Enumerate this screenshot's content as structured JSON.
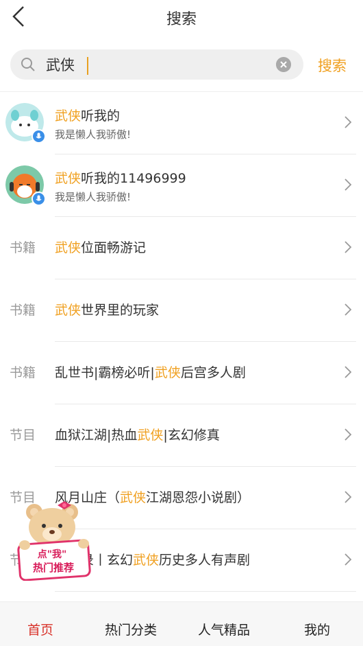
{
  "header": {
    "title": "搜索"
  },
  "search": {
    "value": "武侠",
    "button_label": "搜索"
  },
  "users": [
    {
      "title_highlight": "武侠",
      "title_rest": "听我的",
      "subtitle": "我是懒人我骄傲!"
    },
    {
      "title_highlight": "武侠",
      "title_rest": "听我的11496999",
      "subtitle": "我是懒人我骄傲!"
    }
  ],
  "results": [
    {
      "category": "书籍",
      "pre": "",
      "hl": "武侠",
      "post": "位面畅游记"
    },
    {
      "category": "书籍",
      "pre": "",
      "hl": "武侠",
      "post": "世界里的玩家"
    },
    {
      "category": "书籍",
      "pre": "乱世书|霸榜必听|",
      "hl": "武侠",
      "post": "后宫多人剧"
    },
    {
      "category": "节目",
      "pre": "血狱江湖|热血",
      "hl": "武侠",
      "post": "|玄幻修真"
    },
    {
      "category": "节目",
      "pre": "风月山庄（",
      "hl": "武侠",
      "post": "江湖恩怨小说剧）"
    },
    {
      "category": "节目",
      "pre": "剑灵录丨玄幻",
      "hl": "武侠",
      "post": "历史多人有声剧"
    }
  ],
  "promo": {
    "line1": "点\"我\"",
    "line2": "热门推荐"
  },
  "nav": [
    {
      "label": "首页"
    },
    {
      "label": "热门分类"
    },
    {
      "label": "人气精品"
    },
    {
      "label": "我的"
    }
  ],
  "colors": {
    "accent": "#f0a020",
    "nav_active": "#d8322a",
    "badge": "#3a8fe8"
  }
}
